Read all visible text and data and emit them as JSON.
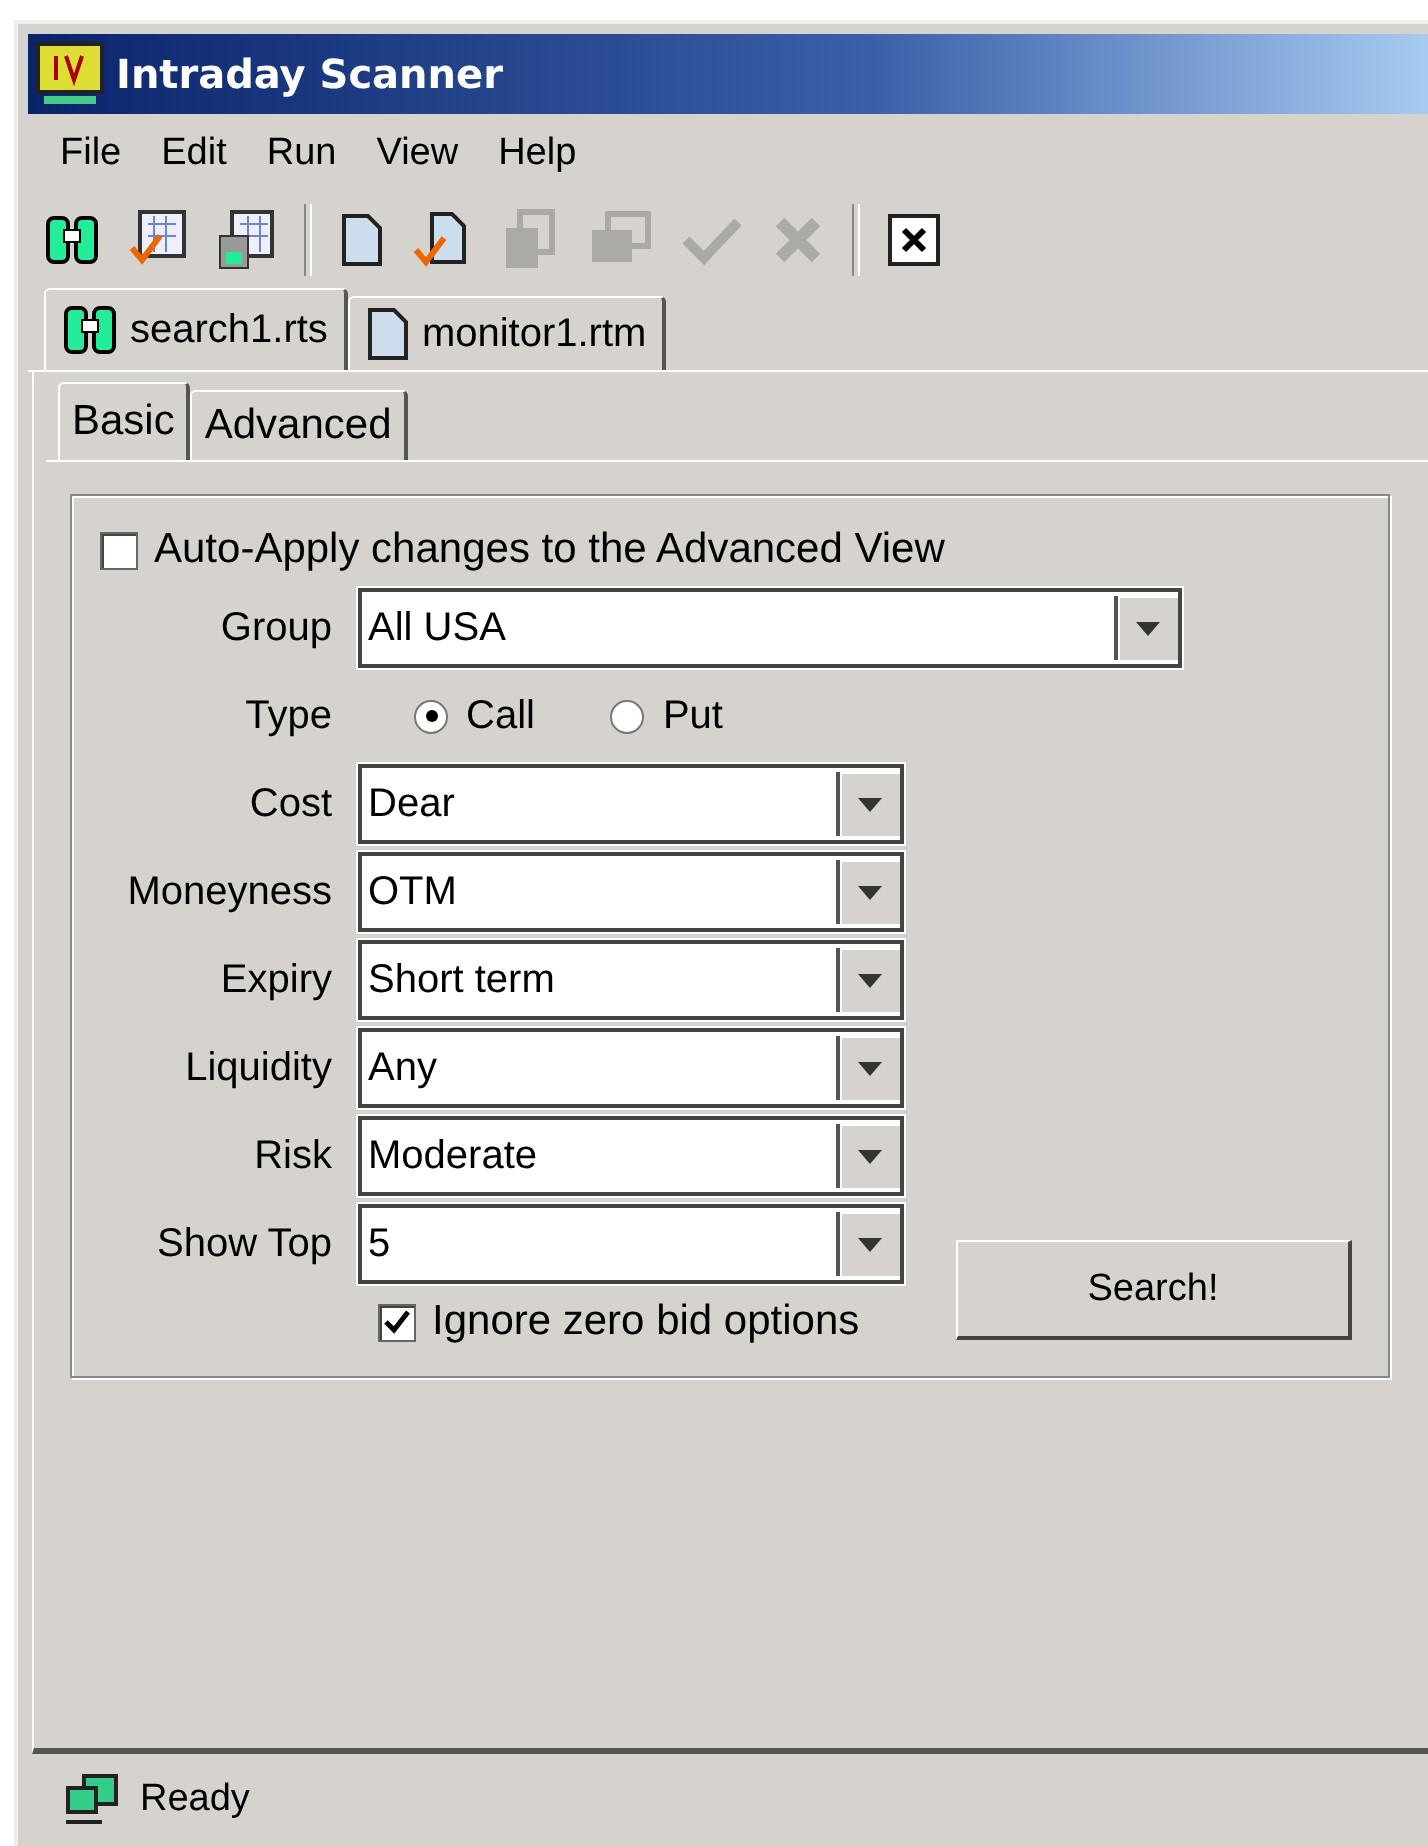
{
  "window": {
    "title": "Intraday Scanner"
  },
  "menu": [
    "File",
    "Edit",
    "Run",
    "View",
    "Help"
  ],
  "toolbar": [
    {
      "kind": "binoculars",
      "disabled": false
    },
    {
      "kind": "grid-check",
      "disabled": false
    },
    {
      "kind": "grid-save",
      "disabled": false
    },
    {
      "kind": "separator"
    },
    {
      "kind": "document",
      "disabled": false
    },
    {
      "kind": "document-check",
      "disabled": false
    },
    {
      "kind": "copy",
      "disabled": true
    },
    {
      "kind": "windows",
      "disabled": true
    },
    {
      "kind": "check",
      "disabled": true
    },
    {
      "kind": "cross",
      "disabled": true
    },
    {
      "kind": "separator"
    },
    {
      "kind": "close",
      "disabled": false
    }
  ],
  "document_tabs": [
    {
      "label": "search1.rts",
      "kind": "binoculars",
      "selected": true
    },
    {
      "label": "monitor1.rtm",
      "kind": "document",
      "selected": false
    }
  ],
  "view_tabs": [
    {
      "label": "Basic",
      "selected": true
    },
    {
      "label": "Advanced",
      "selected": false
    }
  ],
  "auto_apply": {
    "label": "Auto-Apply changes to the Advanced View",
    "checked": false
  },
  "group": {
    "label": "Group",
    "value": "All USA"
  },
  "type": {
    "label": "Type",
    "options": [
      {
        "label": "Call",
        "selected": true
      },
      {
        "label": "Put",
        "selected": false
      }
    ]
  },
  "fields": [
    {
      "label": "Cost",
      "value": "Dear"
    },
    {
      "label": "Moneyness",
      "value": "OTM"
    },
    {
      "label": "Expiry",
      "value": "Short term"
    },
    {
      "label": "Liquidity",
      "value": "Any"
    },
    {
      "label": "Risk",
      "value": "Moderate"
    },
    {
      "label": "Show Top",
      "value": "5"
    }
  ],
  "ignore_zero_bid": {
    "label": "Ignore zero bid options",
    "checked": true
  },
  "search_button": "Search!",
  "status_bar": "Ready"
}
